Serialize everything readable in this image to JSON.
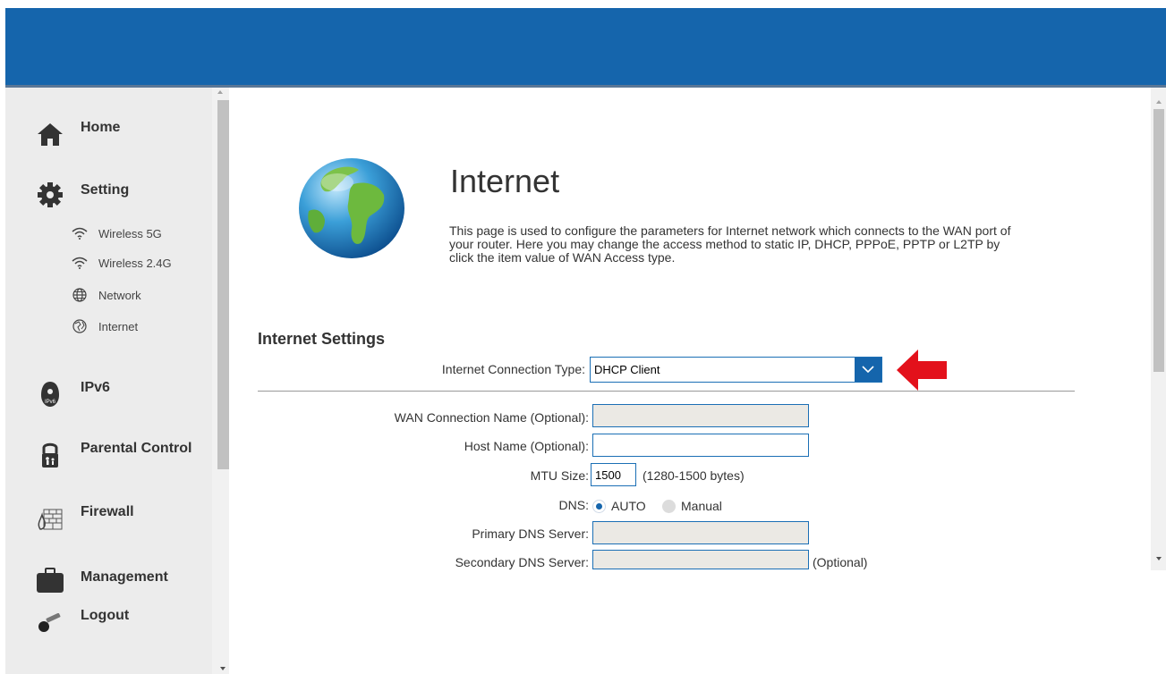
{
  "sidebar": {
    "items": [
      {
        "label": "Home",
        "icon": "home-icon"
      },
      {
        "label": "Setting",
        "icon": "gear-icon"
      },
      {
        "label": "IPv6",
        "icon": "ipv6-icon"
      },
      {
        "label": "Parental Control",
        "icon": "padlock-icon"
      },
      {
        "label": "Firewall",
        "icon": "firewall-icon"
      },
      {
        "label": "Management",
        "icon": "briefcase-icon"
      },
      {
        "label": "Logout",
        "icon": "key-icon"
      }
    ],
    "sub_items": [
      {
        "label": "Wireless 5G",
        "icon": "wifi-icon"
      },
      {
        "label": "Wireless 2.4G",
        "icon": "wifi-icon"
      },
      {
        "label": "Network",
        "icon": "globe-icon"
      },
      {
        "label": "Internet",
        "icon": "globe-icon"
      }
    ]
  },
  "main": {
    "title": "Internet",
    "description": "This page is used to configure the parameters for Internet network which connects to the WAN port of your router. Here you may change the access method to static IP, DHCP, PPPoE, PPTP or L2TP by click the item value of WAN Access type.",
    "section_title": "Internet Settings",
    "connection_type": {
      "label": "Internet Connection Type:",
      "value": "DHCP Client"
    },
    "fields": {
      "wan_name": {
        "label": "WAN Connection Name (Optional):",
        "value": ""
      },
      "host_name": {
        "label": "Host Name (Optional):",
        "value": ""
      },
      "mtu": {
        "label": "MTU Size:",
        "value": "1500",
        "hint": "(1280-1500 bytes)"
      },
      "dns": {
        "label": "DNS:",
        "options": [
          "AUTO",
          "Manual"
        ],
        "selected": "AUTO"
      },
      "primary_dns": {
        "label": "Primary DNS Server:",
        "value": ""
      },
      "secondary_dns": {
        "label": "Secondary DNS Server:",
        "value": "",
        "hint": "(Optional)"
      }
    }
  },
  "colors": {
    "header": "#1565ac",
    "sidebar": "#ececec",
    "accent": "#1565ac",
    "arrow": "#e3111b"
  }
}
